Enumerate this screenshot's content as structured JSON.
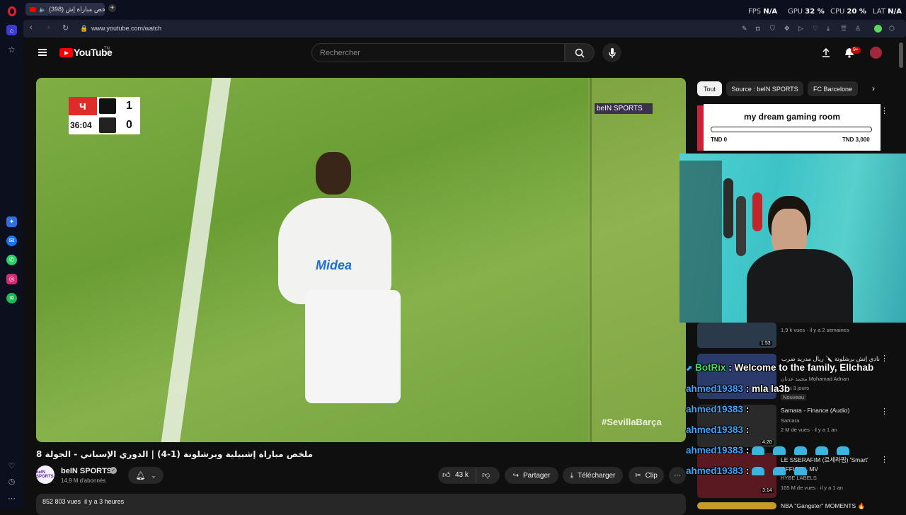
{
  "browser": {
    "tab_label": "(398) ملخص مباراة إش...",
    "url": "www.youtube.com/watch",
    "hud": {
      "fps_label": "FPS",
      "fps_value": "N/A",
      "gpu_label": "GPU",
      "gpu_value": "32 %",
      "cpu_label": "CPU",
      "cpu_value": "20 %",
      "lat_label": "LAT",
      "lat_value": "N/A"
    }
  },
  "header": {
    "wordmark": "YouTube",
    "country": "TN",
    "search_placeholder": "Rechercher",
    "notifications_badge": "9+"
  },
  "video": {
    "scoreboard": {
      "time": "36:04",
      "home_score": "1",
      "away_score": "0"
    },
    "broadcaster": "beIN SPORTS",
    "hashtag": "#SevillaBarça",
    "title": "ملخص مباراة إشبيلية وبرشلونة (1-4) | الدوري الإسباني - الجولة 8"
  },
  "channel": {
    "name": "beIN SPORTS",
    "subscribers": "14,9 M d'abonnés",
    "avatar_text": "beIN SPORTS"
  },
  "actions": {
    "likes": "43 k",
    "share": "Partager",
    "download": "Télécharger",
    "clip": "Clip"
  },
  "description": {
    "views": "852 803 vues",
    "age": "il y a 3 heures"
  },
  "chips": [
    "Tout",
    "Source : beIN SPORTS",
    "FC Barcelone"
  ],
  "donation": {
    "title": "my dream gaming room",
    "min": "TND 0",
    "max": "TND 3,000",
    "progress": 1.0
  },
  "suggestions": [
    {
      "meta": "1,9 k vues · il y a 2 semaines",
      "duration": "1:53"
    },
    {
      "title": "نادي إتش برشلونة 🔪 ريال مدريد ضرب",
      "channel": "محمد عدنان Mohamad Adnan",
      "meta": "il y a 3 jours",
      "badge": "Nouveau"
    },
    {
      "title": "Samara - Finance (Audio)",
      "channel": "Samara",
      "meta": "2 M de vues · il y a 1 an",
      "duration": "4:20"
    },
    {
      "title": "LE SSERAFIM (르세라핌) 'Smart' OFFICIAL MV",
      "channel": "HYBE LABELS",
      "meta": "165 M de vues · il y a 1 an",
      "duration": "3:14"
    },
    {
      "title": "NBA \"Gangster\" MOMENTS 🔥"
    }
  ],
  "chat": [
    {
      "user": "BotRix",
      "message": "Welcome to the family, Ellchab"
    },
    {
      "user": "ahmed19383",
      "message": "mla la3b"
    },
    {
      "user": "ahmed19383",
      "message": ""
    },
    {
      "user": "ahmed19383",
      "message": ""
    },
    {
      "user": "ahmed19383",
      "message": ""
    },
    {
      "user": "ahmed19383",
      "message": ""
    }
  ],
  "colors": {
    "accent": "#ff0000",
    "chat_user": "#3ea6ff",
    "bot_user": "#38e05a",
    "pitch": "#7fae44"
  }
}
